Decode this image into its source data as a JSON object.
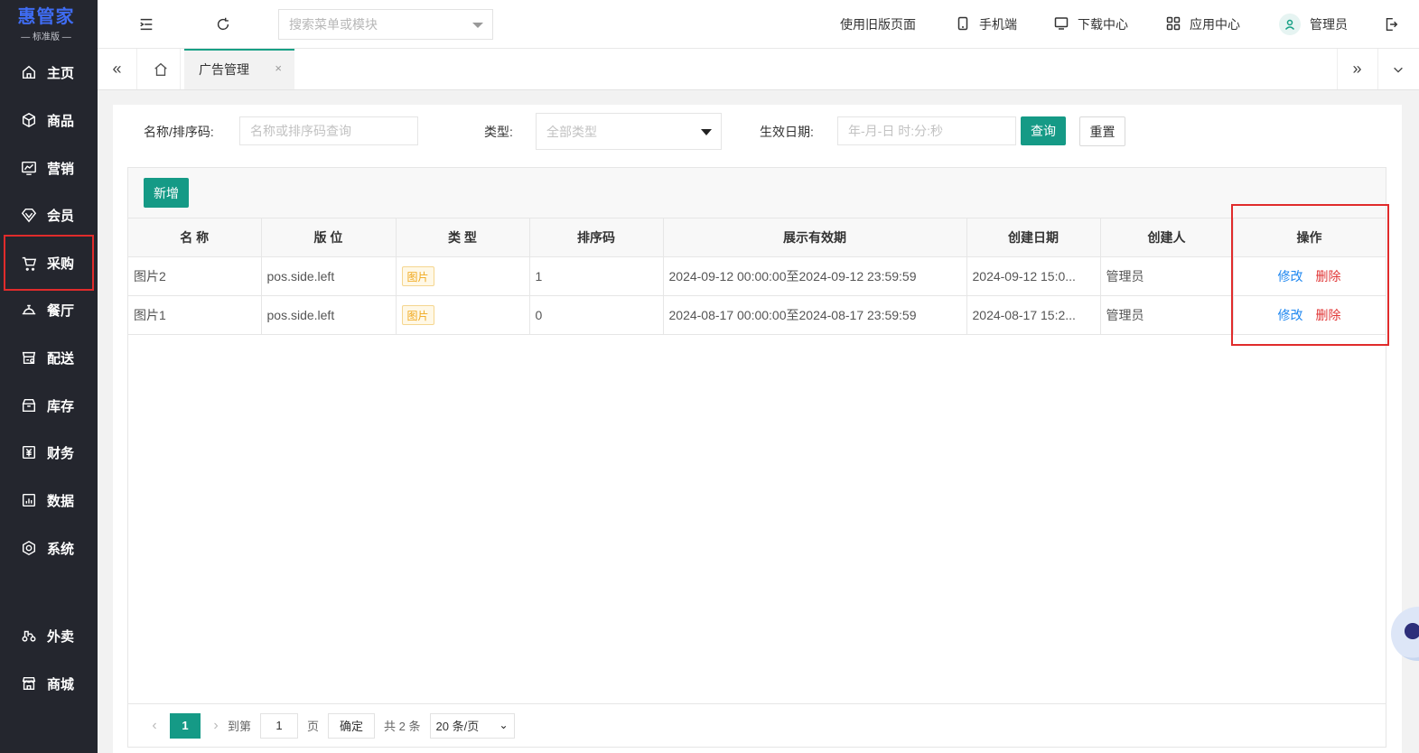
{
  "logo": {
    "main": "惠管家",
    "sub": "— 标准版 —"
  },
  "sidebar": {
    "items": [
      {
        "label": "主页",
        "icon": "home-icon"
      },
      {
        "label": "商品",
        "icon": "box-icon"
      },
      {
        "label": "营销",
        "icon": "chart-icon"
      },
      {
        "label": "会员",
        "icon": "diamond-icon"
      },
      {
        "label": "采购",
        "icon": "cart-icon"
      },
      {
        "label": "餐厅",
        "icon": "dish-icon"
      },
      {
        "label": "配送",
        "icon": "delivery-icon"
      },
      {
        "label": "库存",
        "icon": "warehouse-icon"
      },
      {
        "label": "财务",
        "icon": "finance-icon"
      },
      {
        "label": "数据",
        "icon": "data-icon"
      },
      {
        "label": "系统",
        "icon": "settings-icon"
      },
      {
        "label": "外卖",
        "icon": "scooter-icon"
      },
      {
        "label": "商城",
        "icon": "store-icon"
      }
    ]
  },
  "header": {
    "search_placeholder": "搜索菜单或模块",
    "old_version": "使用旧版页面",
    "mobile": "手机端",
    "download": "下载中心",
    "apps": "应用中心",
    "user": "管理员"
  },
  "tabs": {
    "active": "广告管理",
    "close": "×"
  },
  "filters": {
    "name_label": "名称/排序码:",
    "name_placeholder": "名称或排序码查询",
    "type_label": "类型:",
    "type_value": "全部类型",
    "date_label": "生效日期:",
    "date_placeholder": "年-月-日 时:分:秒",
    "query": "查询",
    "reset": "重置"
  },
  "toolbar": {
    "add": "新增"
  },
  "table": {
    "headers": [
      "名 称",
      "版 位",
      "类 型",
      "排序码",
      "展示有效期",
      "创建日期",
      "创建人",
      "操作"
    ],
    "rows": [
      {
        "name": "图片2",
        "position": "pos.side.left",
        "type": "图片",
        "sort": "1",
        "period": "2024-09-12 00:00:00至2024-09-12 23:59:59",
        "created": "2024-09-12 15:0...",
        "creator": "管理员",
        "edit": "修改",
        "delete": "删除"
      },
      {
        "name": "图片1",
        "position": "pos.side.left",
        "type": "图片",
        "sort": "0",
        "period": "2024-08-17 00:00:00至2024-08-17 23:59:59",
        "created": "2024-08-17 15:2...",
        "creator": "管理员",
        "edit": "修改",
        "delete": "删除"
      }
    ]
  },
  "pager": {
    "current": "1",
    "goto_label": "到第",
    "goto_value": "1",
    "page_unit": "页",
    "confirm": "确定",
    "total": "共 2 条",
    "page_size": "20 条/页"
  },
  "colors": {
    "accent": "#159a86",
    "sidebar_bg": "#24262e",
    "logo": "#3f6cf2",
    "highlight": "#e02b2b"
  }
}
